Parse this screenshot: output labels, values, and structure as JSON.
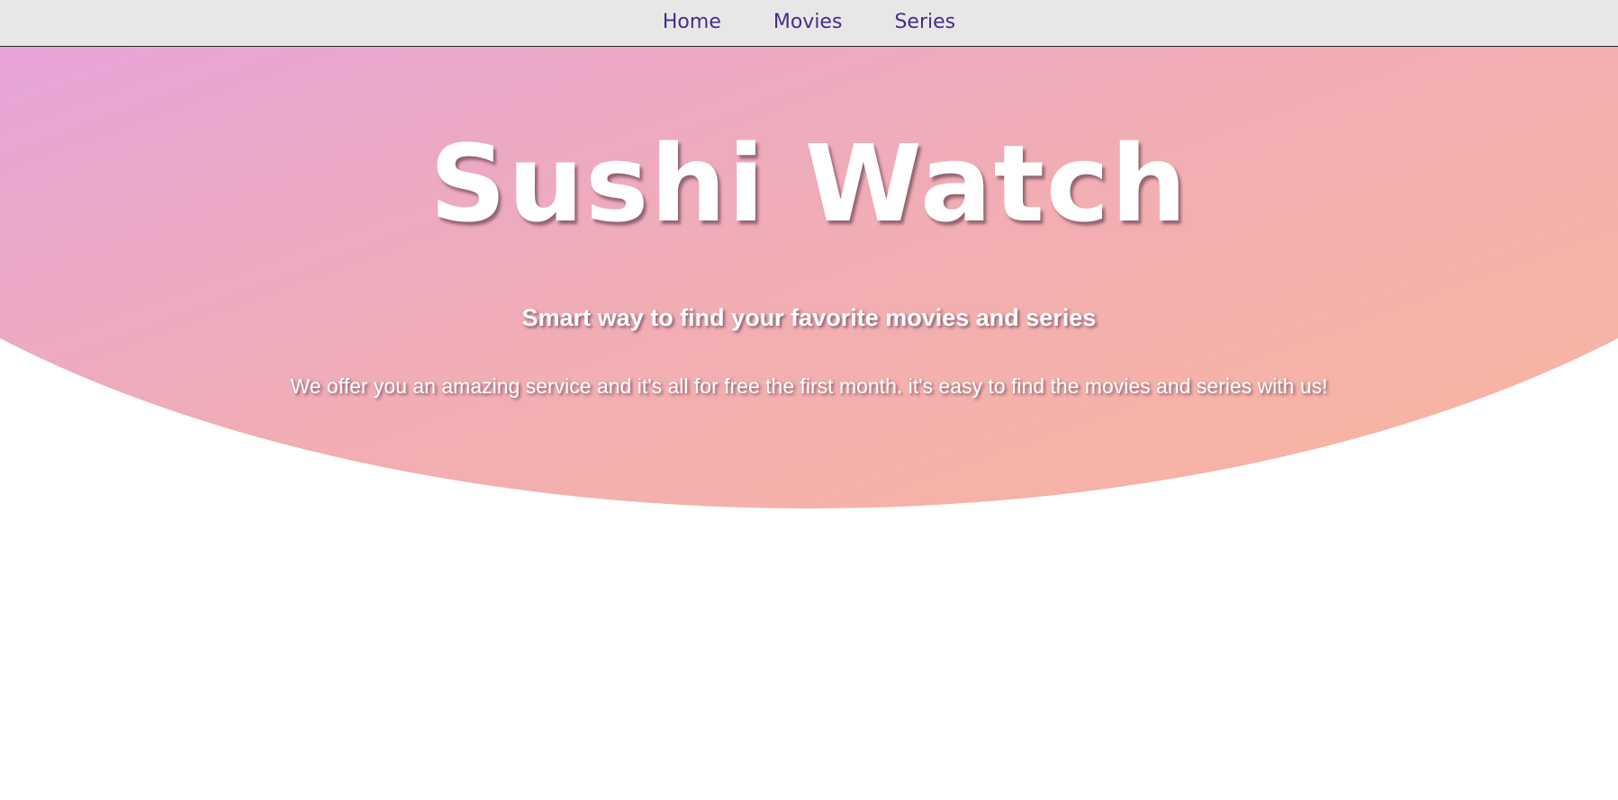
{
  "nav": {
    "items": [
      {
        "label": "Home"
      },
      {
        "label": "Movies"
      },
      {
        "label": "Series"
      }
    ]
  },
  "hero": {
    "title": "Sushi Watch",
    "subtitle": "Smart way to find your favorite movies and series",
    "text": "We offer you an amazing service and it's all for free the first month. it's easy to find the movies and series with us!"
  },
  "colors": {
    "nav_bg": "#e8e7e8",
    "nav_link": "#4a2a8a",
    "gradient_start": "#d693ff",
    "gradient_end": "#fbb899",
    "hero_text": "#ffffff"
  }
}
